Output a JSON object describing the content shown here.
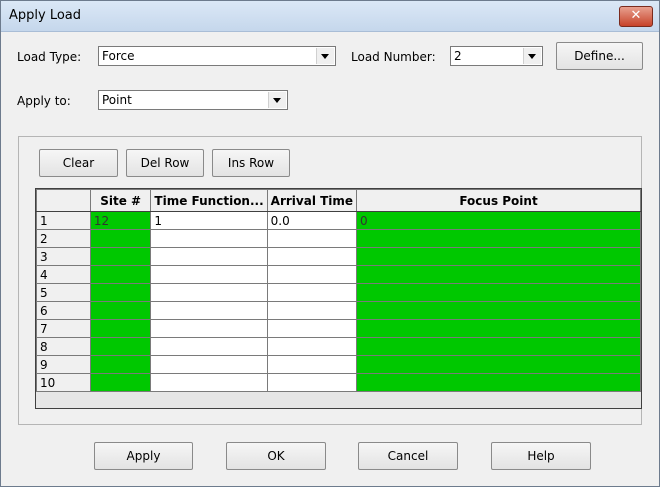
{
  "window": {
    "title": "Apply Load",
    "close_symbol": "✕"
  },
  "form": {
    "load_type_label": "Load Type:",
    "load_type_value": "Force",
    "load_number_label": "Load Number:",
    "load_number_value": "2",
    "define_button": "Define...",
    "apply_to_label": "Apply to:",
    "apply_to_value": "Point"
  },
  "toolbar": {
    "clear": "Clear",
    "del_row": "Del Row",
    "ins_row": "Ins Row"
  },
  "grid": {
    "columns": [
      "",
      "Site #",
      "Time Function...",
      "Arrival Time",
      "Focus Point"
    ],
    "rows": [
      [
        "1",
        "12",
        "1",
        "0.0",
        "0"
      ],
      [
        "2",
        "",
        "",
        "",
        ""
      ],
      [
        "3",
        "",
        "",
        "",
        ""
      ],
      [
        "4",
        "",
        "",
        "",
        ""
      ],
      [
        "5",
        "",
        "",
        "",
        ""
      ],
      [
        "6",
        "",
        "",
        "",
        ""
      ],
      [
        "7",
        "",
        "",
        "",
        ""
      ],
      [
        "8",
        "",
        "",
        "",
        ""
      ],
      [
        "9",
        "",
        "",
        "",
        ""
      ],
      [
        "10",
        "",
        "",
        "",
        ""
      ]
    ],
    "colors": {
      "green": "#00c800",
      "white": "#ffffff"
    }
  },
  "footer": {
    "apply": "Apply",
    "ok": "OK",
    "cancel": "Cancel",
    "help": "Help"
  }
}
